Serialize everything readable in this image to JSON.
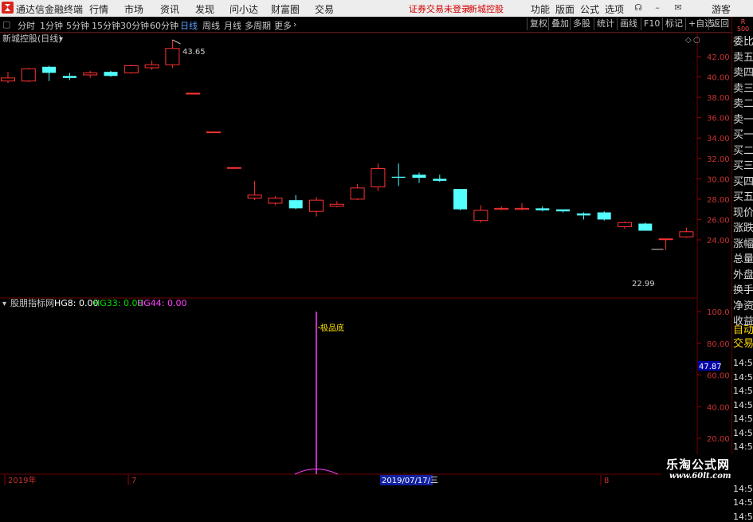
{
  "app": {
    "title": "通达信金融终端",
    "menu": [
      "行情",
      "市场",
      "资讯",
      "发现",
      "问小达",
      "财富圈",
      "交易"
    ],
    "warning": "证券交易未登录",
    "stock_name_top": "新城控股",
    "right_menu": [
      "功能",
      "版面",
      "公式",
      "选项"
    ],
    "guest": "游客"
  },
  "toolbar": {
    "periods": [
      "分时",
      "1分钟",
      "5分钟",
      "15分钟",
      "30分钟",
      "60分钟",
      "日线",
      "周线",
      "月线",
      "多周期",
      "更多"
    ],
    "active_period": "日线",
    "right_buttons": [
      "复权",
      "叠加",
      "多股",
      "统计",
      "画线",
      "F10",
      "标记",
      "+自选",
      "返回"
    ]
  },
  "chart": {
    "title": "新城控股(日线)",
    "high_label": "43.65",
    "low_label": "22.99",
    "price_ticks": [
      "42.00",
      "40.00",
      "38.00",
      "36.00",
      "34.00",
      "32.00",
      "30.00",
      "28.00",
      "26.00",
      "24.00"
    ],
    "indicator_name": "股朋指标网",
    "hg8": "HG8: 0.00",
    "hg33": "HG33: 0.00",
    "hg44": "HG44: 0.00",
    "annotation": "极品底",
    "indicator_ticks": [
      "100.0",
      "80.00",
      "60.00",
      "40.00",
      "20.00"
    ],
    "current_value": "47.87",
    "x_labels": [
      "2019年",
      "7",
      "2019/07/17/三",
      "8"
    ],
    "colors": {
      "up": "#ff3232",
      "down": "#54ffff",
      "hg44": "#ff40ff",
      "hg8": "#ffffff",
      "hg33": "#00e000"
    }
  },
  "chart_data": {
    "type": "candlestick",
    "title": "新城控股(日线)",
    "ylim": [
      22,
      44
    ],
    "candles": [
      {
        "o": 39.6,
        "c": 39.9,
        "h": 40.5,
        "l": 39.4
      },
      {
        "o": 39.6,
        "c": 40.8,
        "h": 40.9,
        "l": 39.5
      },
      {
        "o": 41.0,
        "c": 40.4,
        "h": 41.1,
        "l": 39.6
      },
      {
        "o": 40.1,
        "c": 39.9,
        "h": 40.4,
        "l": 39.7
      },
      {
        "o": 40.2,
        "c": 40.4,
        "h": 40.6,
        "l": 39.9
      },
      {
        "o": 40.5,
        "c": 40.1,
        "h": 40.6,
        "l": 40.0
      },
      {
        "o": 40.4,
        "c": 41.1,
        "h": 41.2,
        "l": 40.3
      },
      {
        "o": 40.9,
        "c": 41.2,
        "h": 41.6,
        "l": 40.7
      },
      {
        "o": 41.2,
        "c": 42.8,
        "h": 43.65,
        "l": 40.9
      },
      {
        "o": 38.4,
        "c": 38.4,
        "h": 38.4,
        "l": 38.4
      },
      {
        "o": 34.6,
        "c": 34.6,
        "h": 34.6,
        "l": 34.6
      },
      {
        "o": 31.1,
        "c": 31.1,
        "h": 31.1,
        "l": 31.1
      },
      {
        "o": 28.1,
        "c": 28.4,
        "h": 29.8,
        "l": 27.9
      },
      {
        "o": 27.6,
        "c": 28.1,
        "h": 28.3,
        "l": 27.4
      },
      {
        "o": 27.9,
        "c": 27.1,
        "h": 28.4,
        "l": 27.0
      },
      {
        "o": 26.8,
        "c": 27.9,
        "h": 28.2,
        "l": 26.3
      },
      {
        "o": 27.3,
        "c": 27.5,
        "h": 27.8,
        "l": 27.2
      },
      {
        "o": 28.0,
        "c": 29.1,
        "h": 29.5,
        "l": 27.9
      },
      {
        "o": 29.2,
        "c": 31.0,
        "h": 31.5,
        "l": 28.8
      },
      {
        "o": 30.2,
        "c": 30.1,
        "h": 31.5,
        "l": 29.3
      },
      {
        "o": 30.4,
        "c": 30.1,
        "h": 30.6,
        "l": 29.6
      },
      {
        "o": 30.0,
        "c": 29.8,
        "h": 30.4,
        "l": 29.7
      },
      {
        "o": 29.0,
        "c": 27.0,
        "h": 29.0,
        "l": 26.9
      },
      {
        "o": 25.9,
        "c": 26.9,
        "h": 27.4,
        "l": 25.7
      },
      {
        "o": 27.0,
        "c": 27.1,
        "h": 27.3,
        "l": 26.9
      },
      {
        "o": 27.0,
        "c": 27.1,
        "h": 27.6,
        "l": 26.9
      },
      {
        "o": 27.1,
        "c": 26.9,
        "h": 27.3,
        "l": 26.8
      },
      {
        "o": 27.0,
        "c": 26.8,
        "h": 27.0,
        "l": 26.7
      },
      {
        "o": 26.6,
        "c": 26.4,
        "h": 26.7,
        "l": 26.0
      },
      {
        "o": 26.7,
        "c": 26.0,
        "h": 26.8,
        "l": 25.9
      },
      {
        "o": 25.3,
        "c": 25.7,
        "h": 25.8,
        "l": 25.1
      },
      {
        "o": 25.6,
        "c": 24.9,
        "h": 25.7,
        "l": 24.9
      },
      {
        "o": 24.1,
        "c": 24.1,
        "h": 24.1,
        "l": 22.99
      },
      {
        "o": 24.3,
        "c": 24.8,
        "h": 25.2,
        "l": 24.2
      }
    ],
    "indicator_ylim": [
      15,
      100
    ],
    "indicator": {
      "spike_index": 15,
      "spike_value": 100,
      "baseline": 0,
      "last_value": 47.87
    }
  },
  "right_panel": {
    "header": [
      "R",
      "500"
    ],
    "items": [
      "委比",
      "卖五",
      "卖四",
      "卖三",
      "卖二",
      "卖一",
      "买一",
      "买二",
      "买三",
      "买四",
      "买五",
      "现价",
      "涨跌",
      "涨幅",
      "总量",
      "外盘",
      "换手",
      "净资",
      "收益"
    ],
    "items2": [
      "自动",
      "交易"
    ],
    "times": [
      "14:5",
      "14:5",
      "14:5",
      "14:5",
      "14:5",
      "14:5",
      "14:5",
      "14:5",
      "14:5",
      "14:5",
      "14:5",
      "14:5"
    ]
  },
  "watermark": {
    "title": "乐淘公式网",
    "url": "www.60lt.com"
  }
}
